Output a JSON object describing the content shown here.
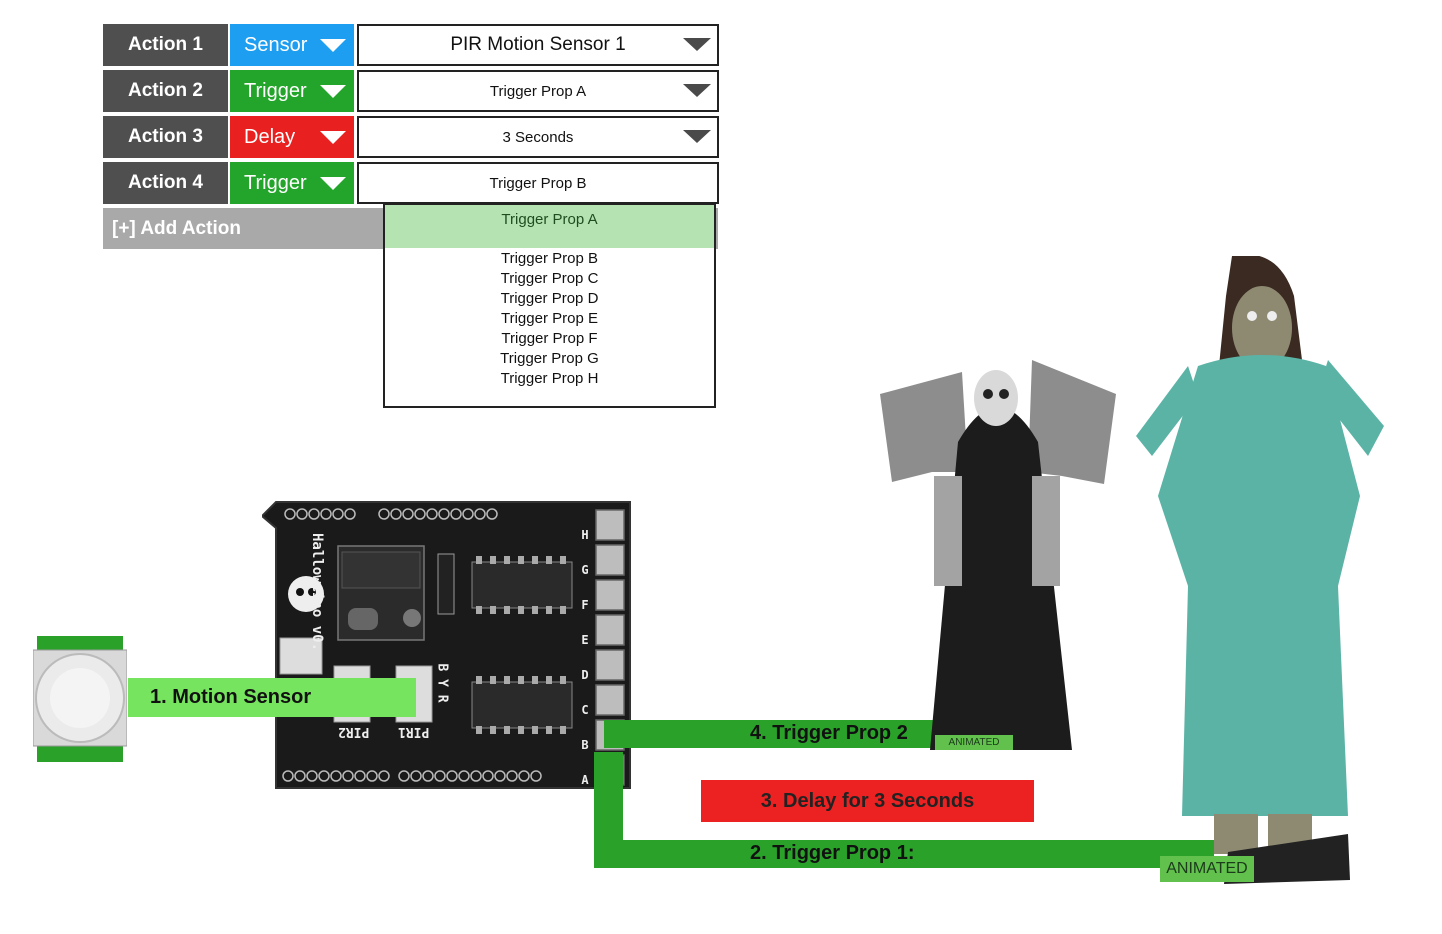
{
  "actions": [
    {
      "label": "Action 1",
      "type": "Sensor",
      "type_color": "#1e9ef0",
      "value": "PIR Motion Sensor 1",
      "has_caret": true
    },
    {
      "label": "Action 2",
      "type": "Trigger",
      "type_color": "#23a42a",
      "value": "Trigger Prop A",
      "has_caret": true
    },
    {
      "label": "Action 3",
      "type": "Delay",
      "type_color": "#e8201f",
      "value": "3 Seconds",
      "has_caret": true
    },
    {
      "label": "Action 4",
      "type": "Trigger",
      "type_color": "#23a42a",
      "value": "Trigger Prop B",
      "has_caret": false
    }
  ],
  "add_action_label": "[+] Add Action",
  "dropdown": {
    "highlighted": "Trigger Prop A",
    "options": [
      "Trigger Prop B",
      "Trigger Prop C",
      "Trigger Prop D",
      "Trigger Prop E",
      "Trigger Prop F",
      "Trigger Prop G",
      "Trigger Prop H"
    ]
  },
  "diagram": {
    "motion_sensor_label": "1. Motion Sensor",
    "trigger_prop_1_label": "2. Trigger Prop 1:",
    "delay_label": "3. Delay for 3 Seconds",
    "trigger_prop_2_label": "4. Trigger Prop 2",
    "animated_badge": "ANIMATED",
    "board": {
      "brand_text": "Halloweino v0.",
      "ports": [
        "H",
        "G",
        "F",
        "E",
        "D",
        "C",
        "B",
        "A"
      ],
      "pir_labels": [
        "PIR2",
        "PIR1"
      ],
      "byr_label": "B Y R"
    },
    "colors": {
      "wire": "#2aa22a",
      "motion_label_bg": "#77e45f",
      "delay_bg": "#ec2222"
    }
  }
}
